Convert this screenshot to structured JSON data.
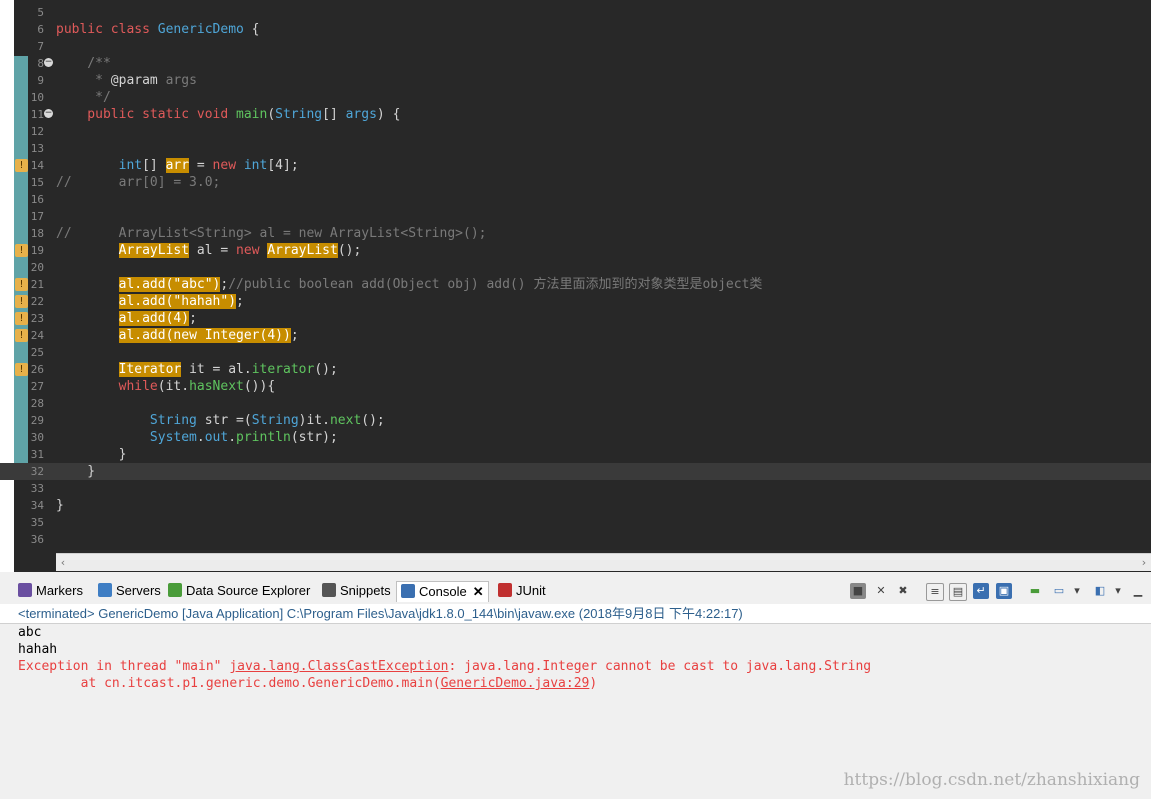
{
  "editor": {
    "lines": [
      {
        "num": "5",
        "segs": []
      },
      {
        "num": "6",
        "segs": [
          [
            "k",
            "public class "
          ],
          [
            "t",
            "GenericDemo"
          ],
          [
            "cl",
            " {"
          ]
        ]
      },
      {
        "num": "7",
        "segs": []
      },
      {
        "num": "8",
        "fold": true,
        "segs": [
          [
            "c",
            "    /**"
          ]
        ]
      },
      {
        "num": "9",
        "segs": [
          [
            "c",
            "     * "
          ],
          [
            "cl",
            "@param"
          ],
          [
            "c",
            " args"
          ]
        ]
      },
      {
        "num": "10",
        "segs": [
          [
            "c",
            "     */"
          ]
        ]
      },
      {
        "num": "11",
        "fold": true,
        "segs": [
          [
            "k",
            "    public static void "
          ],
          [
            "m",
            "main"
          ],
          [
            "cl",
            "("
          ],
          [
            "t",
            "String"
          ],
          [
            "cl",
            "[] "
          ],
          [
            "t",
            "args"
          ],
          [
            "cl",
            ") {"
          ]
        ]
      },
      {
        "num": "12",
        "segs": []
      },
      {
        "num": "13",
        "segs": []
      },
      {
        "num": "14",
        "marker": true,
        "segs": [
          [
            "t",
            "        int"
          ],
          [
            "cl",
            "[] "
          ],
          [
            "hl",
            "arr"
          ],
          [
            "cl",
            " = "
          ],
          [
            "k",
            "new"
          ],
          [
            "t",
            " int"
          ],
          [
            "cl",
            "[4];"
          ]
        ]
      },
      {
        "num": "15",
        "segs": [
          [
            "c",
            "//      arr[0] = 3.0;"
          ]
        ]
      },
      {
        "num": "16",
        "segs": []
      },
      {
        "num": "17",
        "segs": []
      },
      {
        "num": "18",
        "segs": [
          [
            "c",
            "//      ArrayList<String> al = new ArrayList<String>();"
          ]
        ]
      },
      {
        "num": "19",
        "marker": true,
        "segs": [
          [
            "cl",
            "        "
          ],
          [
            "hl",
            "ArrayList"
          ],
          [
            "cl",
            " al = "
          ],
          [
            "k",
            "new "
          ],
          [
            "hl",
            "ArrayList"
          ],
          [
            "cl",
            "();"
          ]
        ]
      },
      {
        "num": "20",
        "segs": []
      },
      {
        "num": "21",
        "marker": true,
        "segs": [
          [
            "cl",
            "        "
          ],
          [
            "hl",
            "al.add(\"abc\")"
          ],
          [
            "cl",
            ";"
          ],
          [
            "c",
            "//public boolean add(Object obj) add() 方法里面添加到的对象类型是object类"
          ]
        ]
      },
      {
        "num": "22",
        "marker": true,
        "segs": [
          [
            "cl",
            "        "
          ],
          [
            "hl",
            "al.add(\"hahah\")"
          ],
          [
            "cl",
            ";"
          ]
        ]
      },
      {
        "num": "23",
        "marker": true,
        "segs": [
          [
            "cl",
            "        "
          ],
          [
            "hl",
            "al.add(4)"
          ],
          [
            "cl",
            ";"
          ]
        ]
      },
      {
        "num": "24",
        "marker": true,
        "segs": [
          [
            "cl",
            "        "
          ],
          [
            "hl",
            "al.add(new Integer(4))"
          ],
          [
            "cl",
            ";"
          ]
        ]
      },
      {
        "num": "25",
        "segs": []
      },
      {
        "num": "26",
        "marker": true,
        "segs": [
          [
            "cl",
            "        "
          ],
          [
            "hl",
            "Iterator"
          ],
          [
            "cl",
            " it = al."
          ],
          [
            "m",
            "iterator"
          ],
          [
            "cl",
            "();"
          ]
        ]
      },
      {
        "num": "27",
        "segs": [
          [
            "k",
            "        while"
          ],
          [
            "cl",
            "(it."
          ],
          [
            "m",
            "hasNext"
          ],
          [
            "cl",
            "()){"
          ]
        ]
      },
      {
        "num": "28",
        "segs": []
      },
      {
        "num": "29",
        "segs": [
          [
            "t",
            "            String"
          ],
          [
            "cl",
            " str =("
          ],
          [
            "t",
            "String"
          ],
          [
            "cl",
            ")it."
          ],
          [
            "m",
            "next"
          ],
          [
            "cl",
            "();"
          ]
        ]
      },
      {
        "num": "30",
        "segs": [
          [
            "t",
            "            System"
          ],
          [
            "cl",
            "."
          ],
          [
            "t",
            "out"
          ],
          [
            "cl",
            "."
          ],
          [
            "m",
            "println"
          ],
          [
            "cl",
            "(str);"
          ]
        ]
      },
      {
        "num": "31",
        "segs": [
          [
            "cl",
            "        }"
          ]
        ]
      },
      {
        "num": "32",
        "current": true,
        "segs": [
          [
            "cl",
            "    }"
          ]
        ]
      },
      {
        "num": "33",
        "segs": []
      },
      {
        "num": "34",
        "segs": [
          [
            "cl",
            "}"
          ]
        ]
      },
      {
        "num": "35",
        "segs": []
      },
      {
        "num": "36",
        "segs": []
      }
    ]
  },
  "console": {
    "tabs": [
      {
        "label": "Markers",
        "name": "markers",
        "icon": "markers-icon",
        "color": "#6a4fa0"
      },
      {
        "label": "Servers",
        "name": "servers",
        "icon": "servers-icon",
        "color": "#3f7ec4"
      },
      {
        "label": "Data Source Explorer",
        "name": "data-source-explorer",
        "icon": "database-icon",
        "color": "#4a9c3a"
      },
      {
        "label": "Snippets",
        "name": "snippets",
        "icon": "snippets-icon",
        "color": "#555555"
      },
      {
        "label": "Console",
        "name": "console",
        "icon": "console-icon",
        "color": "#3a6fb0",
        "active": true
      },
      {
        "label": "JUnit",
        "name": "junit",
        "icon": "junit-icon",
        "color": "#c03030"
      }
    ],
    "status": "<terminated> GenericDemo [Java Application] C:\\Program Files\\Java\\jdk1.8.0_144\\bin\\javaw.exe (2018年9月8日 下午4:22:17)",
    "output": {
      "line1": "abc",
      "line2": "hahah",
      "err1_a": "Exception in thread \"main\" ",
      "err1_link": "java.lang.ClassCastException",
      "err1_b": ": java.lang.Integer cannot be cast to java.lang.String",
      "err2_a": "        at cn.itcast.p1.generic.demo.GenericDemo.main(",
      "err2_link": "GenericDemo.java:29",
      "err2_b": ")"
    }
  },
  "watermark": "https://blog.csdn.net/zhanshixiang"
}
